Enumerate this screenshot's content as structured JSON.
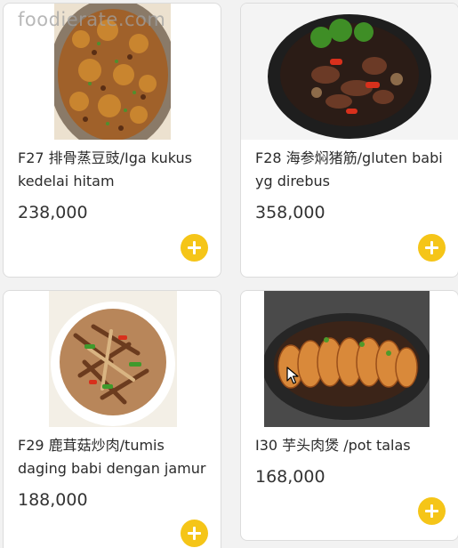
{
  "watermark": "foodierate.com",
  "colors": {
    "accent": "#f5c518",
    "card_bg": "#ffffff",
    "page_bg": "#f2f2f2"
  },
  "products": [
    {
      "code": "F27",
      "title": "F27 排骨蒸豆豉/Iga kukus kedelai hitam",
      "price": "238,000",
      "image": "steamed-pork-ribs-black-bean-photo"
    },
    {
      "code": "F28",
      "title": "F28 海参焖猪筋/gluten babi yg direbus",
      "price": "358,000",
      "image": "braised-sea-cucumber-pork-tendon-photo"
    },
    {
      "code": "F29",
      "title": "F29 鹿茸菇炒肉/tumis daging babi dengan jamur",
      "price": "188,000",
      "image": "stir-fried-mushroom-pork-photo"
    },
    {
      "code": "I30",
      "title": "I30 芋头肉煲 /pot talas",
      "price": "168,000",
      "image": "taro-pork-pot-photo"
    }
  ],
  "add_icon": "plus-icon",
  "cursor_icon": "mouse-pointer-icon"
}
